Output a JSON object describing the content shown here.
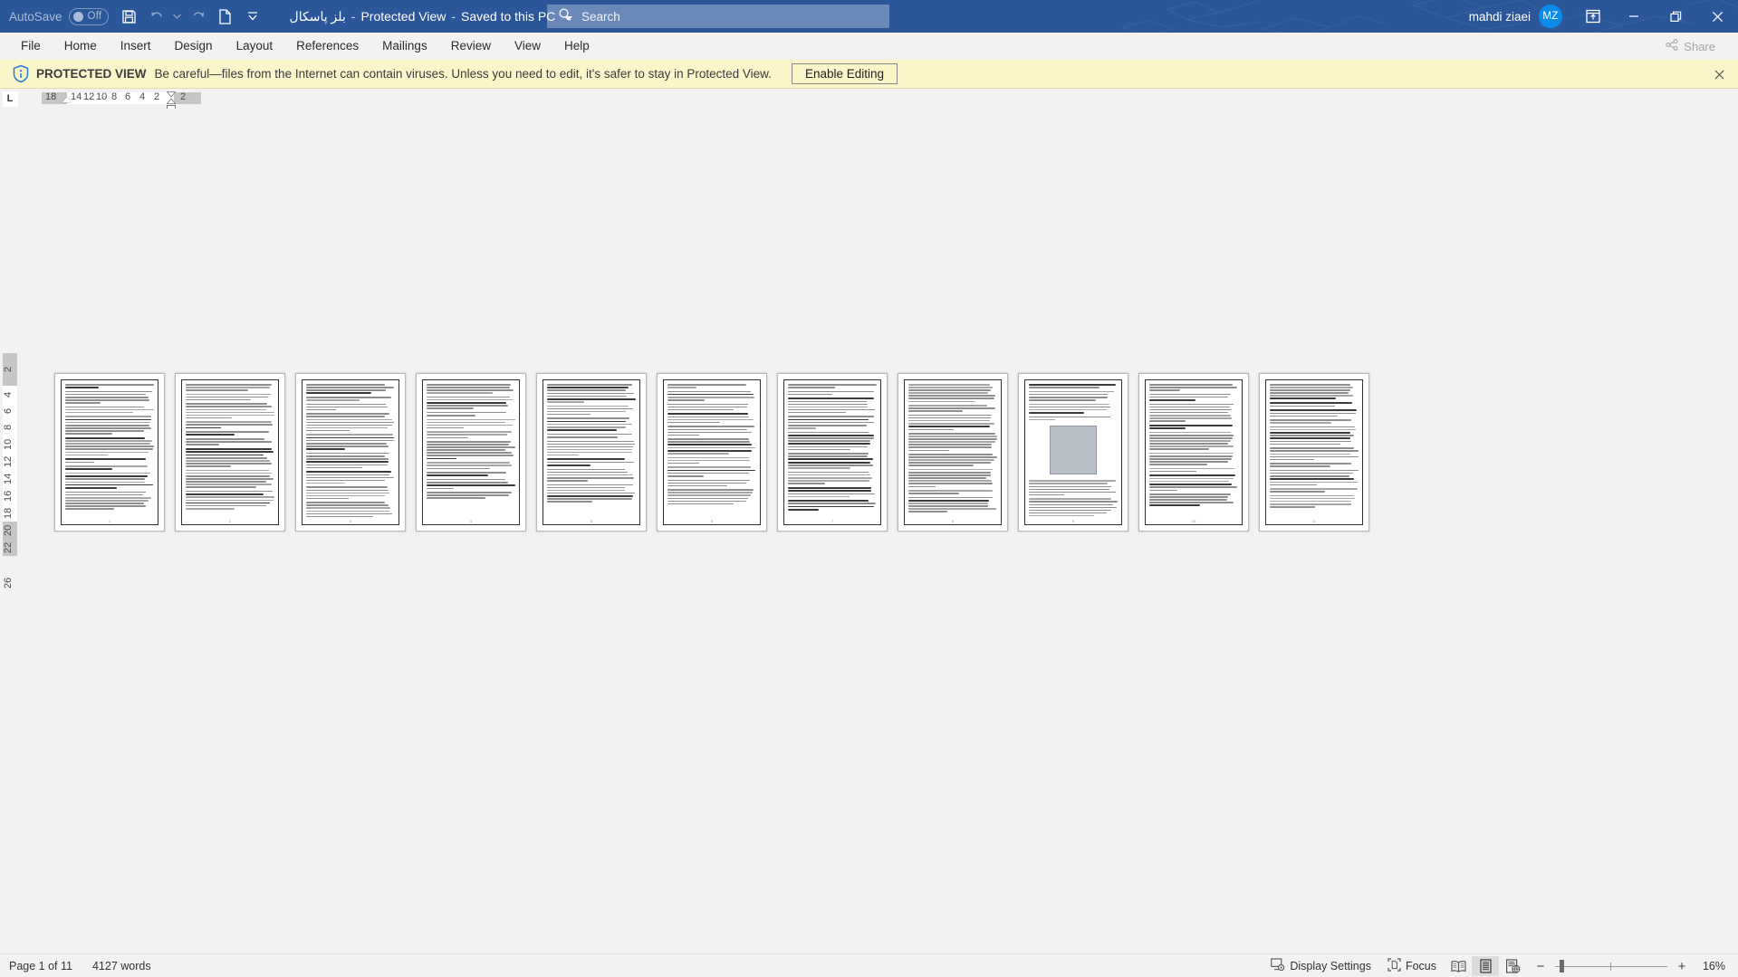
{
  "titlebar": {
    "autosave_label": "AutoSave",
    "autosave_state": "Off",
    "save_icon": "save-icon",
    "undo_icon": "undo-icon",
    "redo_icon": "redo-icon",
    "new_icon": "new-document-icon",
    "customize_icon": "customize-quick-access-toolbar-icon",
    "doc_name": "بلز پاسکال",
    "sep1": "-",
    "mode": "Protected View",
    "sep2": "-",
    "save_location": "Saved to this PC",
    "location_caret": "save-location-dropdown-icon",
    "bg_color": "#2b579a"
  },
  "search": {
    "icon": "search-icon",
    "placeholder": "Search"
  },
  "account": {
    "user_name": "mahdi ziaei",
    "initials": "MZ",
    "avatar_color": "#0b8ce8"
  },
  "window_controls": {
    "ribbon_display_icon": "ribbon-display-options-icon",
    "minimize_icon": "minimize-icon",
    "restore_icon": "restore-icon",
    "close_icon": "close-icon"
  },
  "ribbon": {
    "tabs": [
      {
        "label": "File"
      },
      {
        "label": "Home"
      },
      {
        "label": "Insert"
      },
      {
        "label": "Design"
      },
      {
        "label": "Layout"
      },
      {
        "label": "References"
      },
      {
        "label": "Mailings"
      },
      {
        "label": "Review"
      },
      {
        "label": "View"
      },
      {
        "label": "Help"
      }
    ],
    "share_label": "Share",
    "share_icon": "share-icon"
  },
  "protected_view": {
    "icon": "shield-info-icon",
    "title": "PROTECTED VIEW",
    "message": "Be careful—files from the Internet can contain viruses. Unless you need to edit, it's safer to stay in Protected View.",
    "enable_label": "Enable Editing",
    "close_icon": "close-icon",
    "bg_color": "#fbf6ca"
  },
  "rulers": {
    "tabstop_marker": "L",
    "horizontal_ticks": [
      "18",
      "14",
      "12",
      "10",
      "8",
      "6",
      "4",
      "2",
      "2"
    ],
    "vertical_ticks": [
      "2",
      "4",
      "6",
      "8",
      "10",
      "12",
      "14",
      "16",
      "18",
      "20",
      "22",
      "26"
    ]
  },
  "document": {
    "zoom_view": "multiple-pages",
    "pages": [
      {
        "index": 1,
        "has_image": false,
        "footer": "1"
      },
      {
        "index": 2,
        "has_image": false,
        "footer": "2"
      },
      {
        "index": 3,
        "has_image": false,
        "footer": "3"
      },
      {
        "index": 4,
        "has_image": false,
        "footer": "4"
      },
      {
        "index": 5,
        "has_image": false,
        "footer": "5"
      },
      {
        "index": 6,
        "has_image": false,
        "footer": "6"
      },
      {
        "index": 7,
        "has_image": false,
        "footer": "7"
      },
      {
        "index": 8,
        "has_image": false,
        "footer": "8"
      },
      {
        "index": 9,
        "has_image": true,
        "footer": "9"
      },
      {
        "index": 10,
        "has_image": false,
        "footer": "10"
      },
      {
        "index": 11,
        "has_image": false,
        "footer": "11"
      }
    ]
  },
  "statusbar": {
    "page_status": "Page 1 of 11",
    "word_count": "4127 words",
    "display_settings_label": "Display Settings",
    "display_settings_icon": "display-settings-icon",
    "focus_label": "Focus",
    "focus_icon": "focus-mode-icon",
    "view_read_icon": "read-mode-icon",
    "view_print_icon": "print-layout-icon",
    "view_web_icon": "web-layout-icon",
    "zoom_out_icon": "zoom-out-icon",
    "zoom_in_icon": "zoom-in-icon",
    "zoom_level": "16%"
  }
}
